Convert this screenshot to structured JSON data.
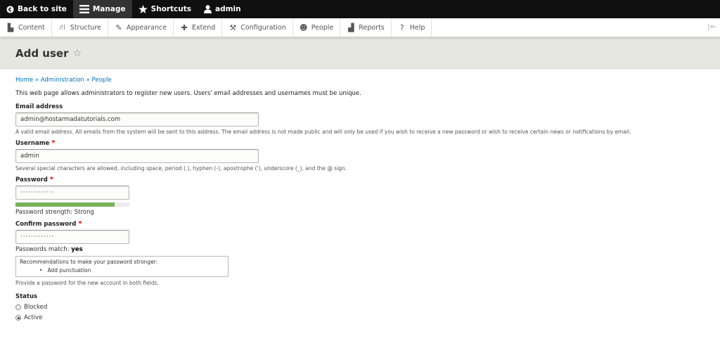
{
  "toolbar": {
    "back_label": "Back to site",
    "manage_label": "Manage",
    "shortcuts_label": "Shortcuts",
    "user_label": "admin"
  },
  "tray": {
    "items": [
      "Content",
      "Structure",
      "Appearance",
      "Extend",
      "Configuration",
      "People",
      "Reports",
      "Help"
    ]
  },
  "page": {
    "title": "Add user",
    "breadcrumb": [
      "Home",
      "Administration",
      "People"
    ],
    "breadcrumb_sep": "»",
    "intro": "This web page allows administrators to register new users. Users' email addresses and usernames must be unique."
  },
  "form": {
    "email": {
      "label": "Email address",
      "value": "admin@hostarmadatutorials.com",
      "description": "A valid email address. All emails from the system will be sent to this address. The email address is not made public and will only be used if you wish to receive a new password or wish to receive certain news or notifications by email."
    },
    "username": {
      "label": "Username",
      "value": "admin",
      "description": "Several special characters are allowed, including space, period (.), hyphen (-), apostrophe ('), underscore (_), and the @ sign."
    },
    "password": {
      "label": "Password",
      "value": "·············",
      "strength_fraction": 0.87,
      "strength_text": "Password strength: Strong"
    },
    "confirm": {
      "label": "Confirm password",
      "value": "·············",
      "match_prefix": "Passwords match: ",
      "match_value": "yes"
    },
    "recommendations": {
      "title": "Recommendations to make your password stronger:",
      "items": [
        "Add punctuation"
      ]
    },
    "provide_text": "Provide a password for the new account in both fields.",
    "status": {
      "label": "Status",
      "options": [
        "Blocked",
        "Active"
      ],
      "selected": "Active"
    }
  },
  "colors": {
    "toolbar_bg": "#0f0f0f",
    "link": "#0074bd",
    "strength": "#77b259",
    "required": "#e00000"
  }
}
